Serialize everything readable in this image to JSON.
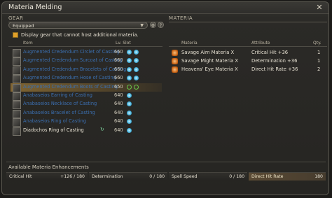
{
  "window": {
    "title": "Materia Melding"
  },
  "gear_section": {
    "heading": "GEAR",
    "filter": {
      "selected": "Equipped"
    },
    "checkbox_label": "Display gear that cannot host additional materia.",
    "columns": {
      "item": "Item",
      "level_slot": "Lv. Slot"
    },
    "items": [
      {
        "name": "Augmented Credendum Circlet of Casting",
        "level": "660",
        "slots": [
          "filled",
          "filled"
        ],
        "color": "#3b6fb0",
        "selected": false
      },
      {
        "name": "Augmented Credendum Surcoat of Casting",
        "level": "660",
        "slots": [
          "filled",
          "filled"
        ],
        "color": "#3b6fb0",
        "selected": false
      },
      {
        "name": "Augmented Credendum Bracelets of Casting",
        "level": "660",
        "slots": [
          "filled",
          "filled"
        ],
        "color": "#3b6fb0",
        "selected": false
      },
      {
        "name": "Augmented Credendum Hose of Casting",
        "level": "660",
        "slots": [
          "filled",
          "filled"
        ],
        "color": "#3b6fb0",
        "selected": false
      },
      {
        "name": "Augmented Credendum Boots of Casting",
        "level": "650",
        "slots": [
          "empty",
          "empty"
        ],
        "color": "#3b6fb0",
        "selected": true
      },
      {
        "name": "Anabaseios Earring of Casting",
        "level": "640",
        "slots": [
          "filled"
        ],
        "color": "#3b6fb0",
        "selected": false
      },
      {
        "name": "Anabaseios Necklace of Casting",
        "level": "640",
        "slots": [
          "filled"
        ],
        "color": "#3b6fb0",
        "selected": false
      },
      {
        "name": "Anabaseios Bracelet of Casting",
        "level": "640",
        "slots": [
          "filled"
        ],
        "color": "#3b6fb0",
        "selected": false
      },
      {
        "name": "Anabaseios Ring of Casting",
        "level": "640",
        "slots": [
          "filled"
        ],
        "color": "#3b6fb0",
        "selected": false
      },
      {
        "name": "Diadochos Ring of Casting",
        "level": "640",
        "slots": [
          "filled"
        ],
        "color": "#e6e0d2",
        "selected": false,
        "spin_icon": true
      }
    ]
  },
  "materia_section": {
    "heading": "MATERIA",
    "columns": {
      "materia": "Materia",
      "attribute": "Attribute",
      "qty": "Qty."
    },
    "items": [
      {
        "name": "Savage Aim Materia X",
        "attribute": "Critical Hit +36",
        "qty": "1"
      },
      {
        "name": "Savage Might Materia X",
        "attribute": "Determination +36",
        "qty": "1"
      },
      {
        "name": "Heavens' Eye Materia X",
        "attribute": "Direct Hit Rate +36",
        "qty": "2"
      }
    ]
  },
  "enhancements": {
    "title": "Available Materia Enhancements",
    "stats": [
      {
        "label": "Critical Hit",
        "value": "+126 / 180",
        "maxed": false
      },
      {
        "label": "Determination",
        "value": "0 / 180",
        "maxed": false
      },
      {
        "label": "Spell Speed",
        "value": "0 / 180",
        "maxed": false
      },
      {
        "label": "Direct Hit Rate",
        "value": "180",
        "maxed": true
      }
    ]
  },
  "colors": {
    "accent": "#e0a02a",
    "materia_slot": "#4ab6e0",
    "empty_slot": "#69c94b"
  }
}
